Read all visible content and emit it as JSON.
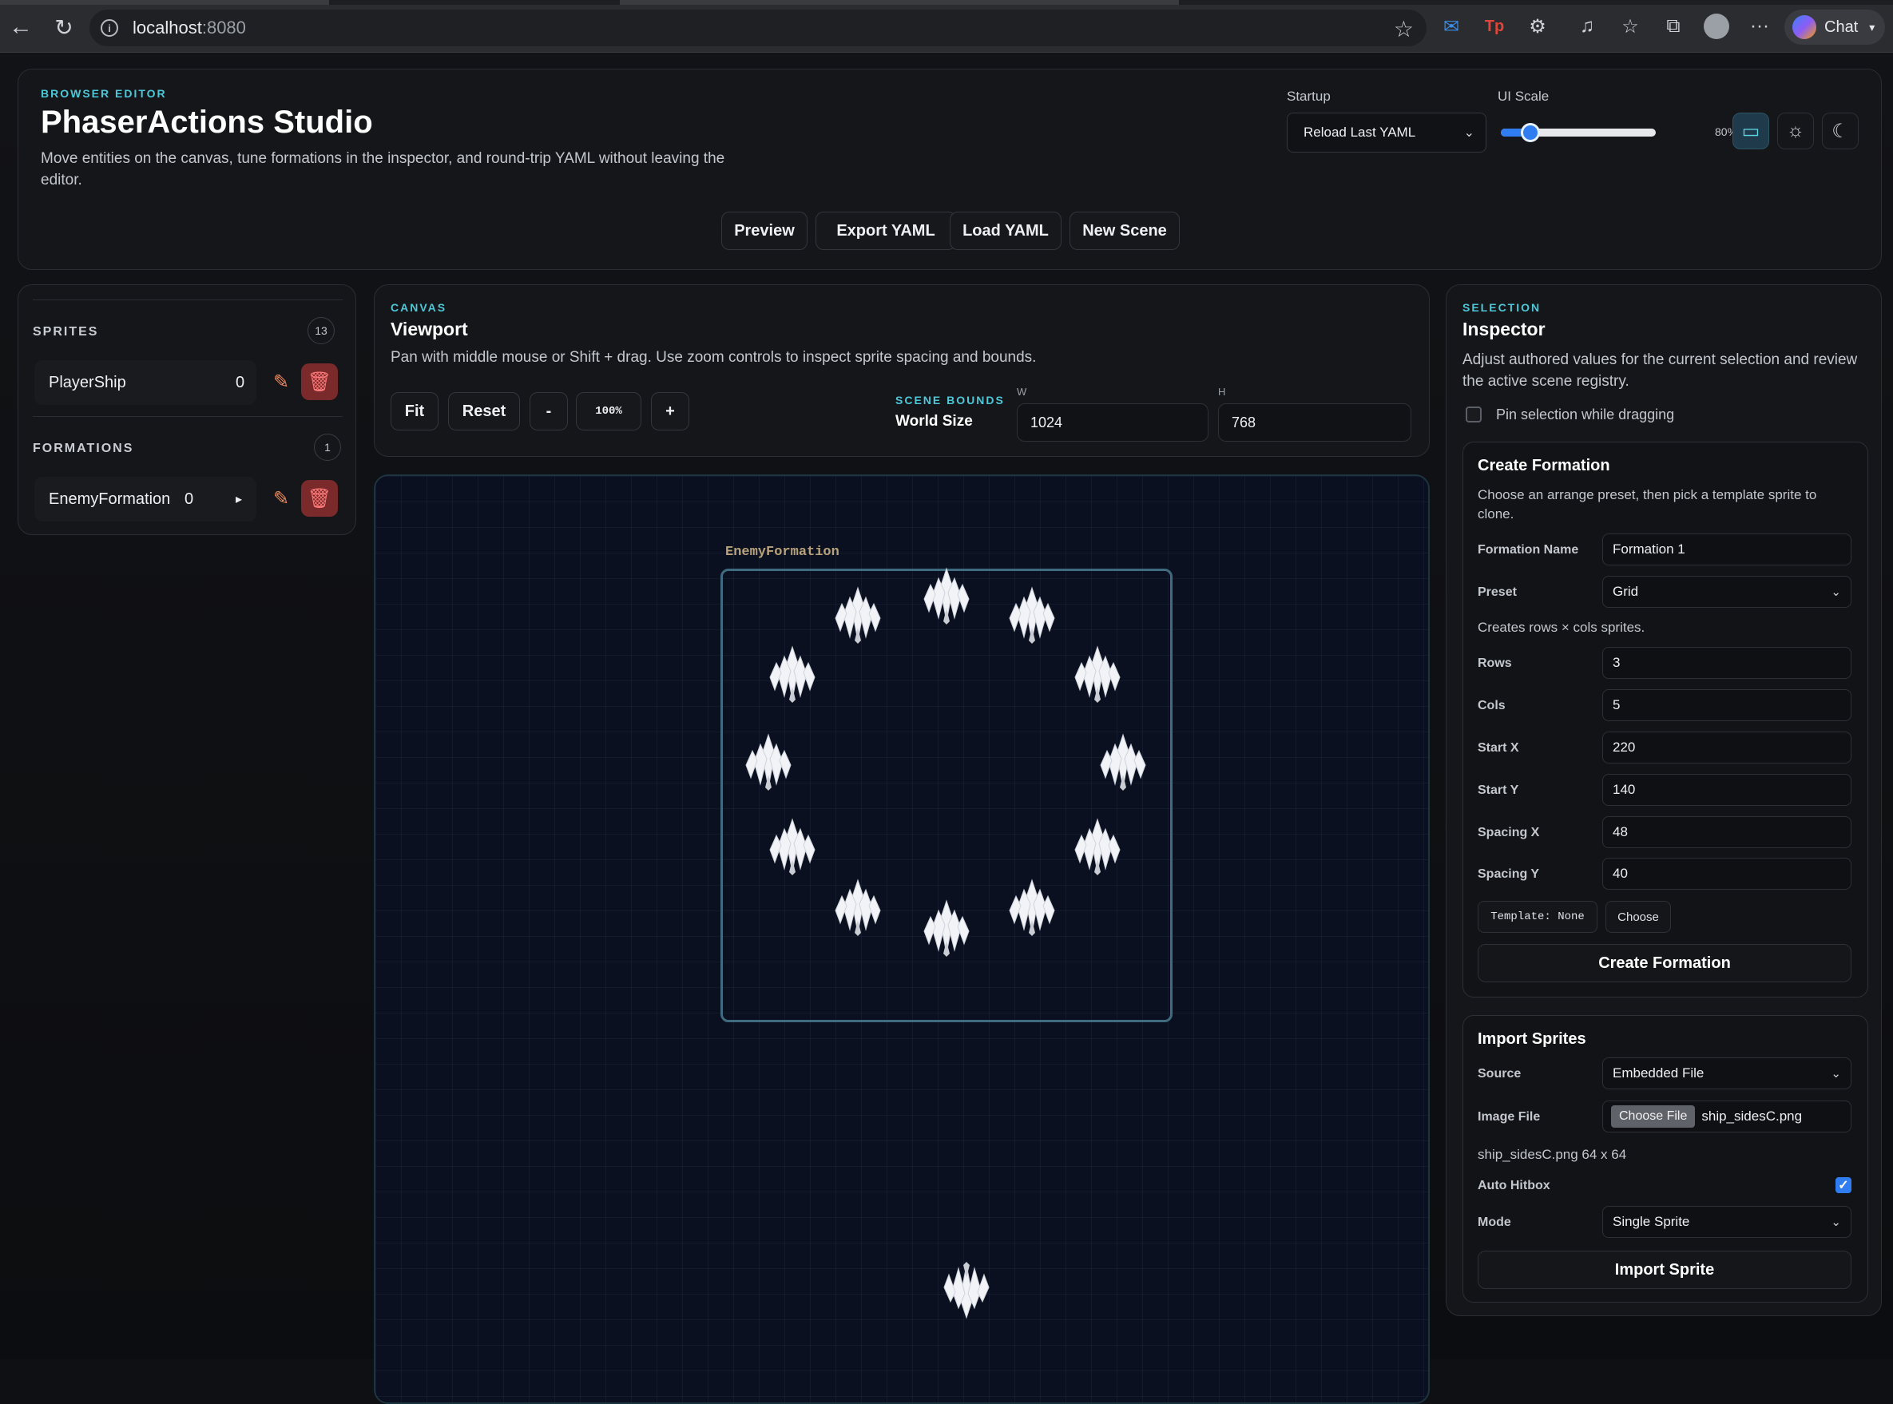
{
  "browser": {
    "url_host": "localhost",
    "url_port": ":8080",
    "chat_label": "Chat"
  },
  "header": {
    "eyebrow": "BROWSER EDITOR",
    "title": "PhaserActions Studio",
    "description": "Move entities on the canvas, tune formations in the inspector, and round-trip YAML without leaving the editor.",
    "startup_label": "Startup",
    "startup_value": "Reload Last YAML",
    "ui_scale_label": "UI Scale",
    "ui_scale_value": "80%",
    "ui_scale_fraction": 0.16,
    "buttons": {
      "preview": "Preview",
      "export": "Export YAML",
      "load": "Load YAML",
      "new_scene": "New Scene"
    }
  },
  "sidebar": {
    "sprites_title": "SPRITES",
    "sprites_count": "13",
    "sprite_item": {
      "name": "PlayerShip",
      "value": "0"
    },
    "formations_title": "FORMATIONS",
    "formations_count": "1",
    "formation_item": {
      "name": "EnemyFormation",
      "value": "0",
      "arrow": "▸"
    }
  },
  "canvas": {
    "eyebrow": "CANVAS",
    "title": "Viewport",
    "description": "Pan with middle mouse or Shift + drag. Use zoom controls to inspect sprite spacing and bounds.",
    "fit": "Fit",
    "reset": "Reset",
    "zoom_out": "-",
    "zoom": "100%",
    "zoom_in": "+",
    "bounds_label": "SCENE BOUNDS",
    "world_size_label": "World Size",
    "w_label": "W",
    "h_label": "H",
    "width": "1024",
    "height": "768",
    "formation_label": "EnemyFormation"
  },
  "inspector": {
    "eyebrow": "SELECTION",
    "title": "Inspector",
    "description": "Adjust authored values for the current selection and review the active scene registry.",
    "pin_label": "Pin selection while dragging",
    "create": {
      "title": "Create Formation",
      "description": "Choose an arrange preset, then pick a template sprite to clone.",
      "name_label": "Formation Name",
      "name_value": "Formation 1",
      "preset_label": "Preset",
      "preset_value": "Grid",
      "preset_note": "Creates rows × cols sprites.",
      "rows_label": "Rows",
      "rows_value": "3",
      "cols_label": "Cols",
      "cols_value": "5",
      "startx_label": "Start X",
      "startx_value": "220",
      "starty_label": "Start Y",
      "starty_value": "140",
      "spacingx_label": "Spacing X",
      "spacingx_value": "48",
      "spacingy_label": "Spacing Y",
      "spacingy_value": "40",
      "template_label": "Template: None",
      "choose_label": "Choose",
      "submit": "Create Formation"
    },
    "import": {
      "title": "Import Sprites",
      "source_label": "Source",
      "source_value": "Embedded File",
      "image_label": "Image File",
      "choose_file": "Choose File",
      "file_name": "ship_sidesC.png",
      "file_info": "ship_sidesC.png 64 x 64",
      "auto_hitbox_label": "Auto Hitbox",
      "mode_label": "Mode",
      "mode_value": "Single Sprite",
      "submit": "Import Sprite"
    }
  }
}
